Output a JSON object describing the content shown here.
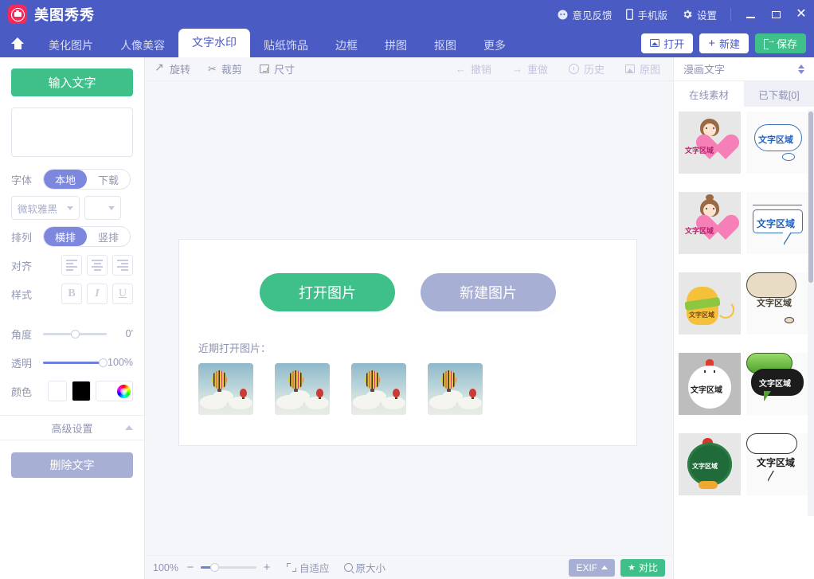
{
  "titlebar": {
    "app_name": "美图秀秀",
    "logo_icon": "meitu-logo-icon",
    "feedback": "意见反馈",
    "feedback_icon": "chat-bubble-icon",
    "mobile": "手机版",
    "mobile_icon": "phone-icon",
    "settings": "设置",
    "settings_icon": "gear-icon",
    "minimize_icon": "minimize-icon",
    "maximize_icon": "maximize-icon",
    "close_icon": "close-icon",
    "close_glyph": "✕",
    "bg_color": "#4a5bc4"
  },
  "nav": {
    "home_icon": "home-icon",
    "tabs": [
      {
        "label": "美化图片",
        "active": false
      },
      {
        "label": "人像美容",
        "active": false
      },
      {
        "label": "文字水印",
        "active": true
      },
      {
        "label": "贴纸饰品",
        "active": false
      },
      {
        "label": "边框",
        "active": false
      },
      {
        "label": "拼图",
        "active": false
      },
      {
        "label": "抠图",
        "active": false
      },
      {
        "label": "更多",
        "active": false
      }
    ],
    "actions": [
      {
        "label": "打开",
        "icon": "image-icon",
        "style": "white"
      },
      {
        "label": "新建",
        "icon": "plus-icon",
        "style": "white"
      },
      {
        "label": "保存",
        "icon": "save-icon",
        "style": "green"
      }
    ]
  },
  "sidebar": {
    "input_text_button": "输入文字",
    "textarea_value": "",
    "font": {
      "label": "字体",
      "options": [
        {
          "label": "本地",
          "active": true
        },
        {
          "label": "下载",
          "active": false
        }
      ],
      "family_value": "微软雅黑",
      "size_value": ""
    },
    "arrange": {
      "label": "排列",
      "options": [
        {
          "label": "横排",
          "active": true
        },
        {
          "label": "竖排",
          "active": false
        }
      ]
    },
    "align": {
      "label": "对齐",
      "buttons": [
        "align-left-icon",
        "align-center-icon",
        "align-right-icon"
      ]
    },
    "style": {
      "label": "样式",
      "buttons": [
        {
          "glyph": "B",
          "name": "bold-icon"
        },
        {
          "glyph": "I",
          "name": "italic-icon"
        },
        {
          "glyph": "U",
          "name": "underline-icon"
        }
      ]
    },
    "angle": {
      "label": "角度",
      "value": "0'",
      "percent": 50
    },
    "opacity": {
      "label": "透明",
      "value": "100%",
      "percent": 100
    },
    "color": {
      "label": "颜色",
      "swatch_white": "#ffffff",
      "swatch_black": "#000000",
      "picker_icon": "color-wheel-icon"
    },
    "advanced": "高级设置",
    "advanced_chevron": "chevron-up-icon",
    "delete_text_button": "删除文字"
  },
  "canvas_toolbar": {
    "left": [
      {
        "label": "旋转",
        "icon": "rotate-icon",
        "enabled": true
      },
      {
        "label": "裁剪",
        "icon": "scissors-icon",
        "enabled": true,
        "glyph": "✂"
      },
      {
        "label": "尺寸",
        "icon": "resize-icon",
        "enabled": true
      }
    ],
    "right": [
      {
        "label": "撤销",
        "icon": "undo-arrow-icon",
        "enabled": false,
        "glyph": "←"
      },
      {
        "label": "重做",
        "icon": "redo-arrow-icon",
        "enabled": false,
        "glyph": "→"
      },
      {
        "label": "历史",
        "icon": "clock-icon",
        "enabled": false
      },
      {
        "label": "原图",
        "icon": "original-image-icon",
        "enabled": false
      }
    ]
  },
  "main": {
    "open_image_button": "打开图片",
    "new_image_button": "新建图片",
    "recent_label": "近期打开图片：",
    "recent_thumbs": [
      {
        "name": "hot-air-balloon-thumb-1"
      },
      {
        "name": "hot-air-balloon-thumb-2"
      },
      {
        "name": "hot-air-balloon-thumb-3"
      },
      {
        "name": "hot-air-balloon-thumb-4"
      }
    ]
  },
  "statusbar": {
    "zoom_value": "100%",
    "zoom_minus": "−",
    "zoom_plus": "+",
    "zoom_percent": 22,
    "fit_label": "自适应",
    "fit_icon": "fit-screen-icon",
    "actual_label": "原大小",
    "actual_icon": "magnifier-icon",
    "exif_label": "EXIF",
    "exif_caret": "caret-up-icon",
    "compare_label": "对比",
    "compare_icon": "star-icon",
    "compare_glyph": "★"
  },
  "right_panel": {
    "category": "漫画文字",
    "category_icon": "up-down-arrow-icon",
    "tabs": [
      {
        "label": "在线素材",
        "active": true
      },
      {
        "label": "已下载[0]",
        "active": false
      }
    ],
    "sticker_text": "文字区域",
    "stickers": [
      {
        "name": "girl-heart-sticker-1",
        "type": "girl",
        "text": "文字区域"
      },
      {
        "name": "cloud-bubble-sticker-1",
        "type": "cloud",
        "text": "文字区域"
      },
      {
        "name": "girl-heart-sticker-2",
        "type": "girl",
        "text": "文字区域"
      },
      {
        "name": "rect-bubble-sticker",
        "type": "rect",
        "text": "文字区域"
      },
      {
        "name": "mitten-sticker",
        "type": "mitten",
        "text": "文字区域"
      },
      {
        "name": "beige-cloud-bubble-sticker",
        "type": "beige",
        "text": "文字区域"
      },
      {
        "name": "chicken-sticker",
        "type": "chick",
        "text": "文字区域"
      },
      {
        "name": "green-bubble-sticker",
        "type": "green",
        "text": "文字区域"
      },
      {
        "name": "wreath-sticker",
        "type": "wreath",
        "text": "文字区域"
      },
      {
        "name": "white-bubble-sticker",
        "type": "white",
        "text": "文字区域"
      }
    ],
    "scrollbar_icon": "vertical-scrollbar"
  },
  "colors": {
    "brand_blue": "#4a5bc4",
    "accent_green": "#3fc08a",
    "accent_purple": "#7d87dd",
    "muted_purple": "#a8afd4",
    "canvas_bg": "#f5f6fa"
  }
}
